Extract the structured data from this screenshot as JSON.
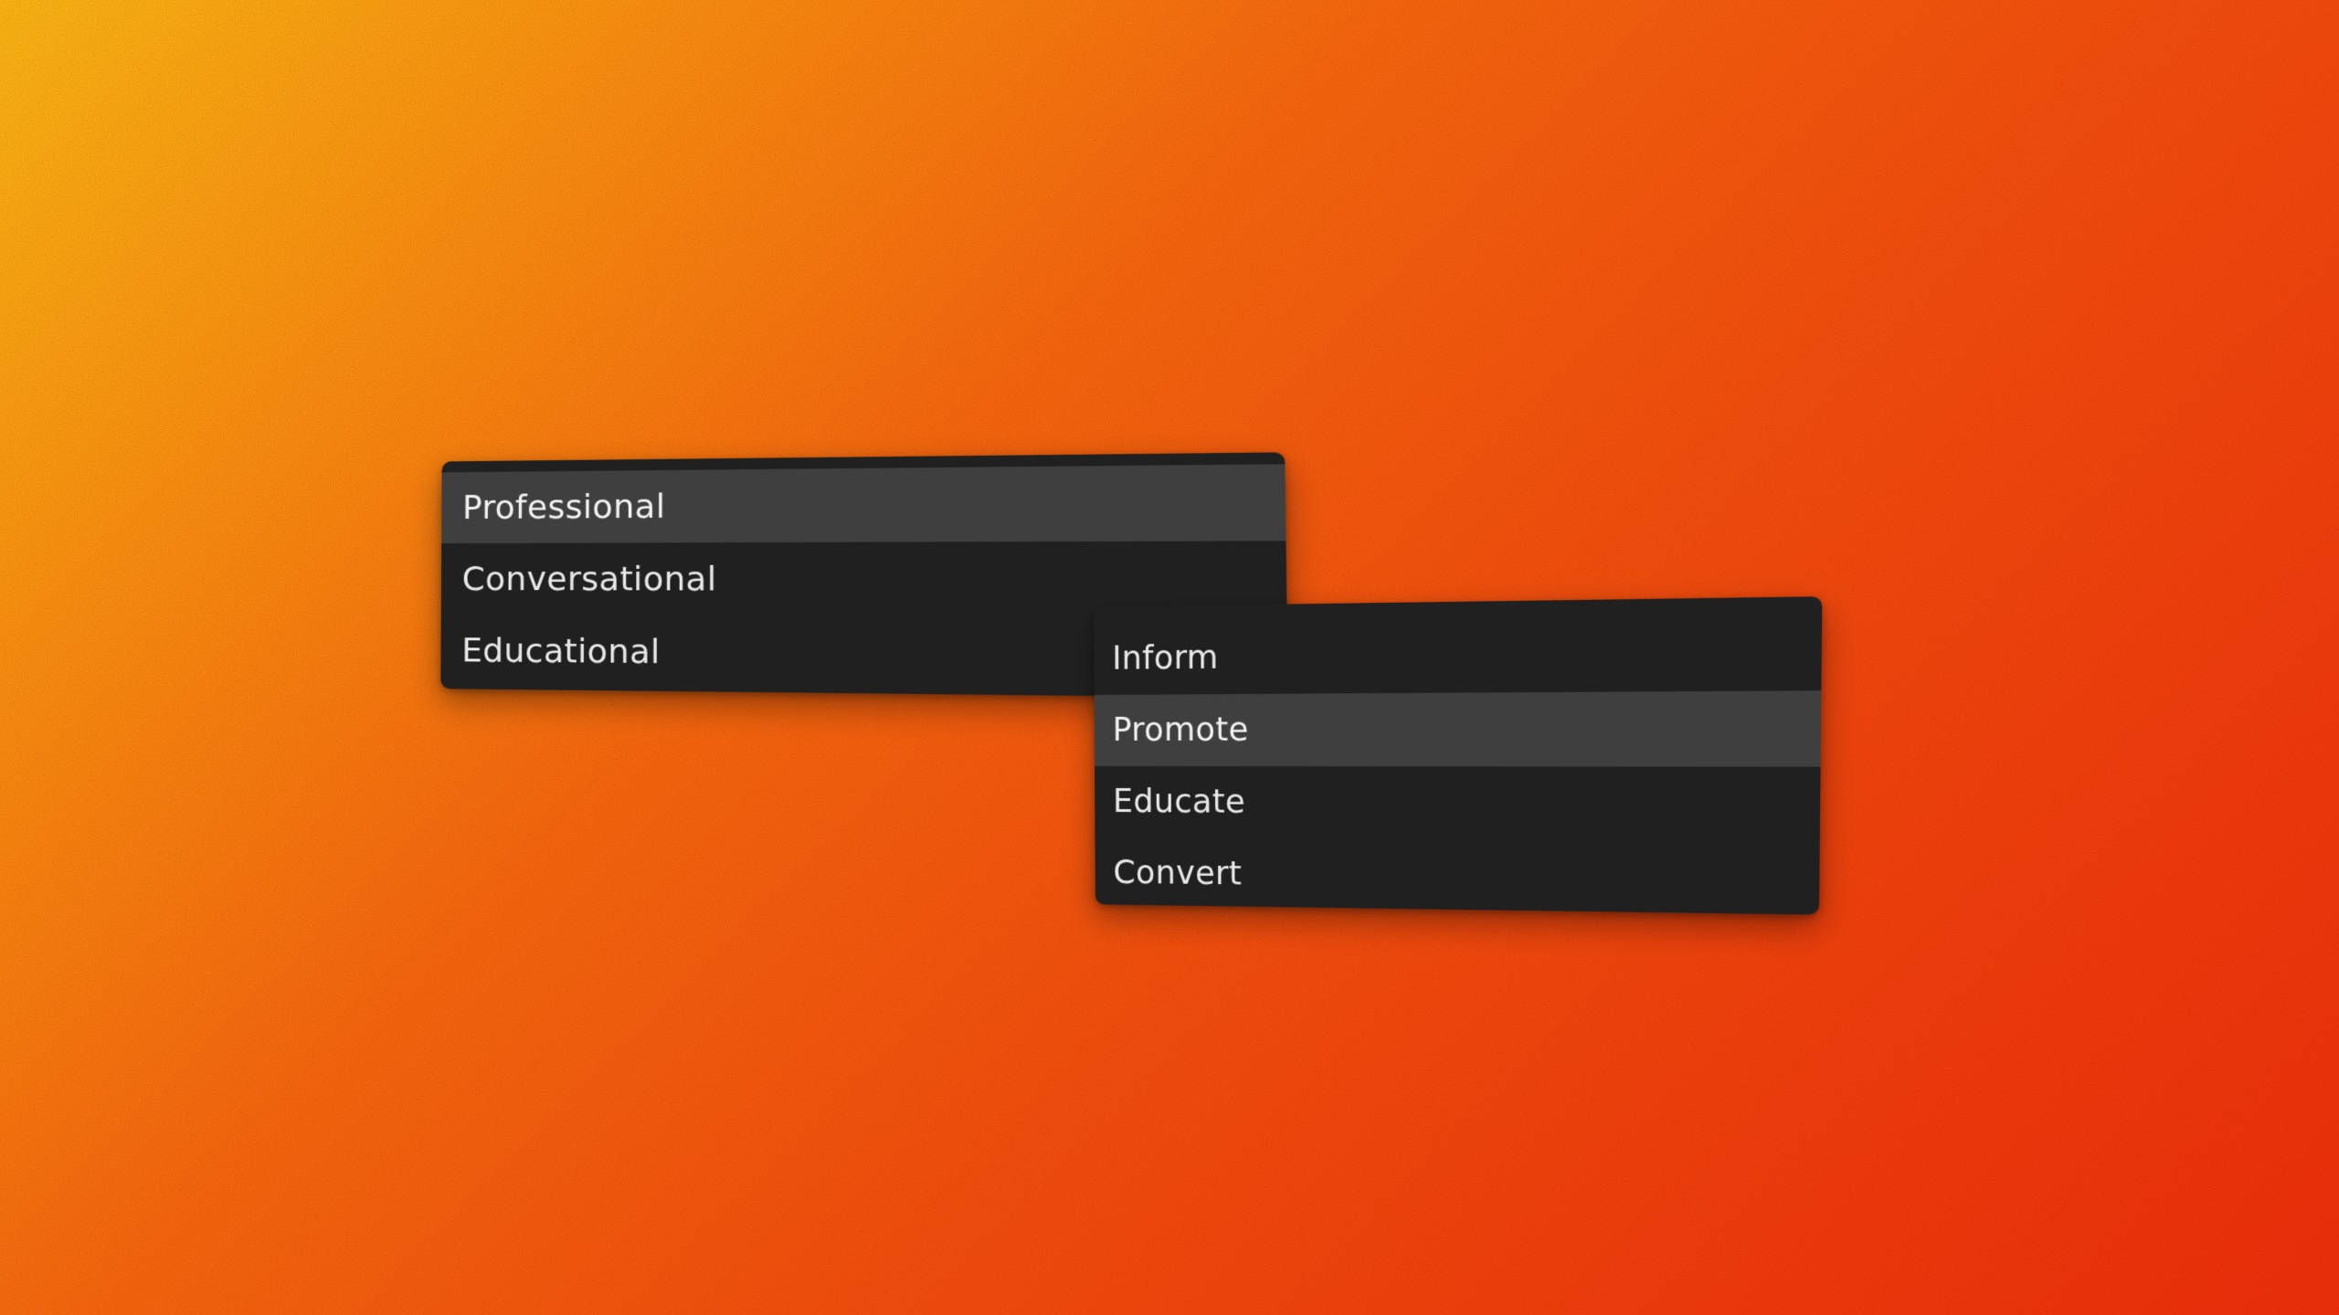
{
  "tone_menu": {
    "items": [
      {
        "label": "Professional",
        "active": true
      },
      {
        "label": "Conversational",
        "active": false
      },
      {
        "label": "Educational",
        "active": false
      }
    ]
  },
  "goal_menu": {
    "items": [
      {
        "label": "Inform",
        "active": false
      },
      {
        "label": "Promote",
        "active": true
      },
      {
        "label": "Educate",
        "active": false
      },
      {
        "label": "Convert",
        "active": false
      }
    ]
  },
  "colors": {
    "background_start": "#fcbc14",
    "background_end": "#ef300b",
    "menu_background": "#202020",
    "menu_item_highlight": "#3f3f3f",
    "menu_text": "#e8e8e8"
  }
}
